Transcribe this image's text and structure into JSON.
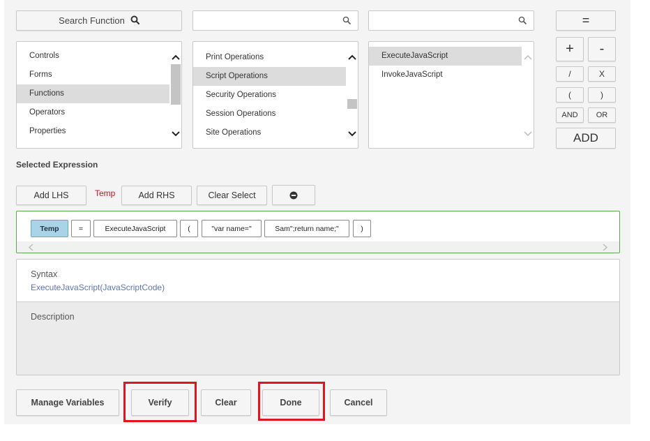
{
  "search_function": {
    "label": "Search Function",
    "icon": "search-icon"
  },
  "search_inputs": [
    {
      "placeholder": "",
      "value": ""
    },
    {
      "placeholder": "",
      "value": ""
    }
  ],
  "categories": {
    "items": [
      {
        "label": "Controls"
      },
      {
        "label": "Forms"
      },
      {
        "label": "Functions",
        "selected": true
      },
      {
        "label": "Operators"
      },
      {
        "label": "Properties"
      }
    ]
  },
  "subcategories": {
    "items": [
      {
        "label": "Print Operations"
      },
      {
        "label": "Script Operations",
        "selected": true
      },
      {
        "label": "Security Operations"
      },
      {
        "label": "Session Operations"
      },
      {
        "label": "Site Operations"
      }
    ]
  },
  "functions": {
    "items": [
      {
        "label": "ExecuteJavaScript",
        "selected": true
      },
      {
        "label": "InvokeJavaScript"
      }
    ]
  },
  "operators": {
    "equals": "=",
    "plus": "+",
    "minus": "-",
    "divide": "/",
    "multiply": "X",
    "open_paren": "(",
    "close_paren": ")",
    "and": "AND",
    "or": "OR",
    "add": "ADD"
  },
  "selected_expression": {
    "label": "Selected Expression",
    "add_lhs": "Add LHS",
    "lhs_value": "Temp",
    "add_rhs": "Add RHS",
    "clear_select": "Clear Select",
    "remove_icon": "minus-circle-icon"
  },
  "expression_tokens": [
    {
      "text": "Temp",
      "active": true
    },
    {
      "text": "="
    },
    {
      "text": "ExecuteJavaScript"
    },
    {
      "text": "("
    },
    {
      "text": "\"var name=\""
    },
    {
      "text": "Sam\";return name;\""
    },
    {
      "text": ")"
    }
  ],
  "syntax": {
    "label": "Syntax",
    "value": "ExecuteJavaScript(JavaScriptCode)"
  },
  "description": {
    "label": "Description",
    "value": ""
  },
  "footer": {
    "manage_variables": "Manage Variables",
    "verify": "Verify",
    "clear": "Clear",
    "done": "Done",
    "cancel": "Cancel"
  },
  "colors": {
    "highlight": "#e0141c",
    "expression_border": "#5aa84c",
    "active_token": "#a9d3e6",
    "syntax_text": "#5b76b8",
    "lhs_text": "#c8141e"
  }
}
